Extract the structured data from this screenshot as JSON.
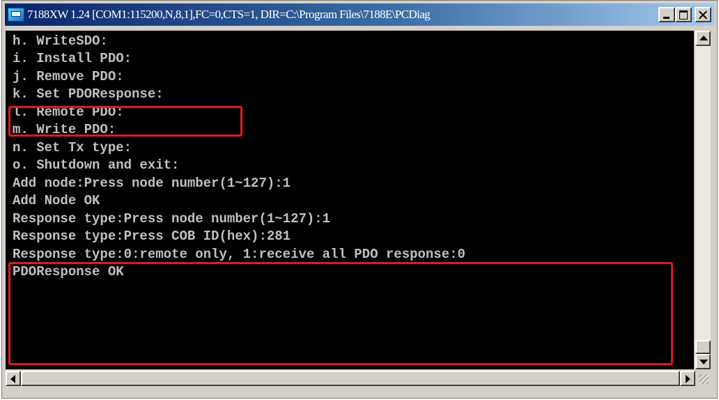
{
  "window": {
    "title": "7188XW 1.24 [COM1:115200,N,8,1],FC=0,CTS=1, DIR=C:\\Program Files\\7188E\\PCDiag",
    "app_icon": "console-app-icon",
    "controls": {
      "minimize": "minimize-icon",
      "maximize": "maximize-icon",
      "close": "close-icon"
    }
  },
  "console": {
    "lines": [
      "h. WriteSDO:",
      "i. Install PDO:",
      "j. Remove PDO:",
      "k. Set PDOResponse:",
      "l. Remote PDO:",
      "m. Write PDO:",
      "n. Set Tx type:",
      "o. Shutdown and exit:",
      "Add node:Press node number(1~127):1",
      "Add Node OK",
      "Response type:Press node number(1~127):1",
      "Response type:Press COB ID(hex):281",
      "Response type:0:remote only, 1:receive all PDO response:0",
      "PDOResponse OK"
    ],
    "text_color": "#c0c0c0",
    "background": "#000000"
  },
  "annotations": {
    "highlight_color": "#e01a1a"
  },
  "scrollbars": {
    "vertical": {
      "up": "scroll-up-arrow-icon",
      "down": "scroll-down-arrow-icon"
    },
    "horizontal": {
      "left": "scroll-left-arrow-icon",
      "right": "scroll-right-arrow-icon"
    }
  }
}
